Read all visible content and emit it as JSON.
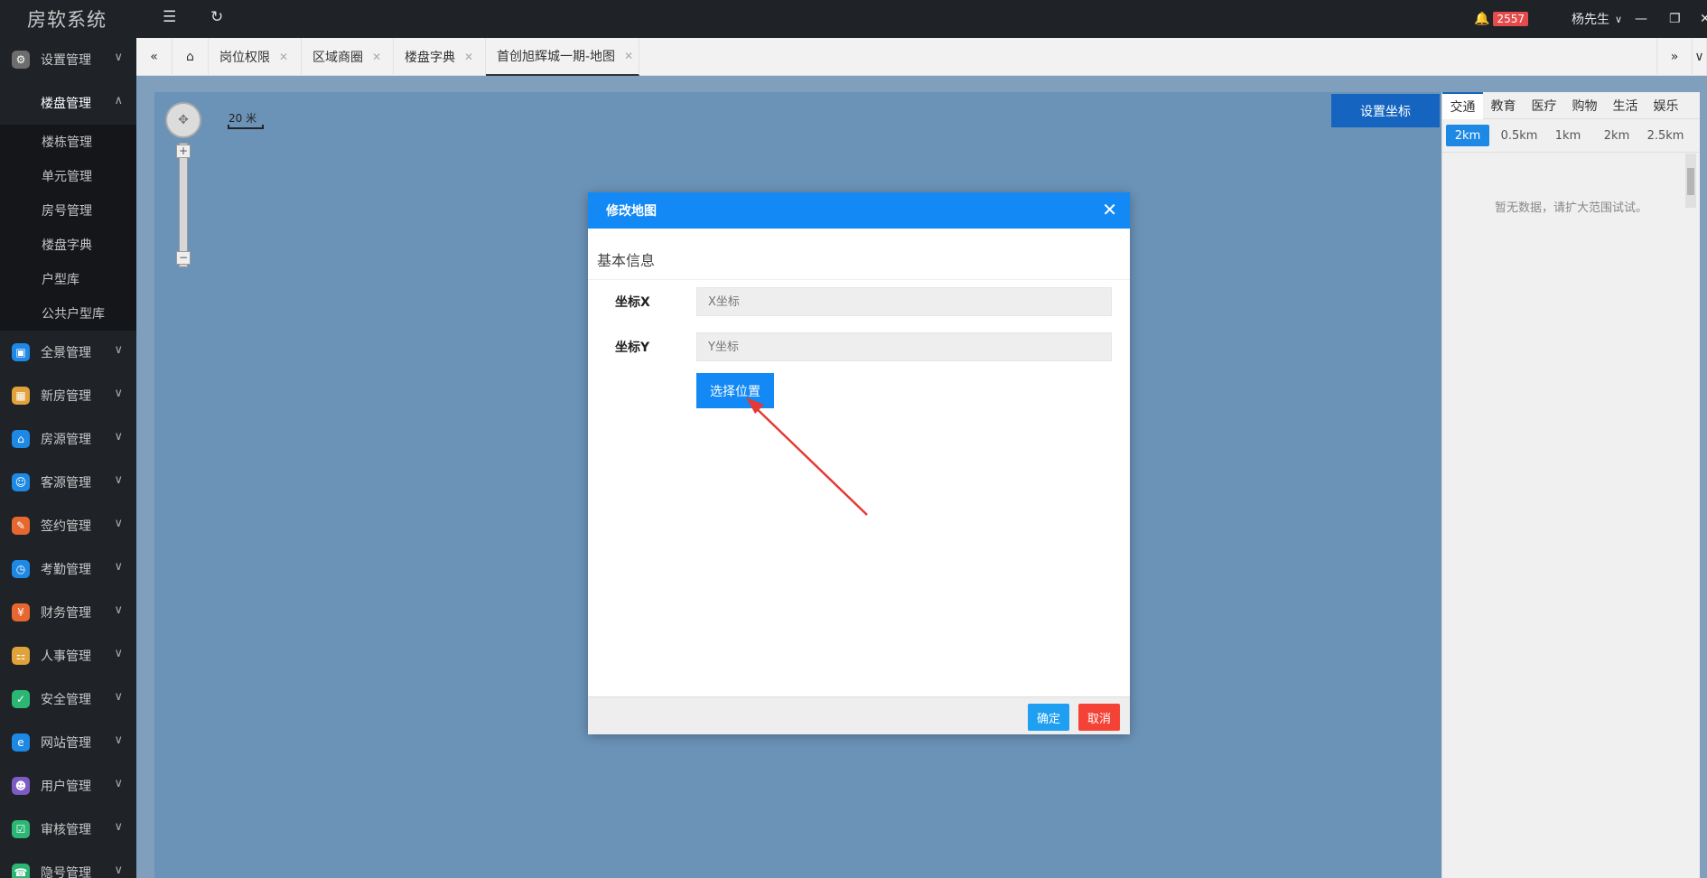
{
  "app": {
    "title": "房软系统"
  },
  "topbar": {
    "notification_count": "2557",
    "user_name": "杨先生"
  },
  "sidebar": {
    "items": [
      {
        "label": "设置管理",
        "icon": "gear-icon",
        "color": "#6d6d6d"
      },
      {
        "label": "楼盘管理",
        "icon": "building-icon",
        "color": "#1f2227"
      }
    ],
    "subitems": [
      "楼栋管理",
      "单元管理",
      "房号管理",
      "楼盘字典",
      "户型库",
      "公共户型库"
    ],
    "more": [
      {
        "label": "全景管理",
        "icon": "panorama-icon",
        "color": "#1e88e5"
      },
      {
        "label": "新房管理",
        "icon": "newhouse-icon",
        "color": "#e0a23a"
      },
      {
        "label": "房源管理",
        "icon": "home-icon",
        "color": "#1e88e5"
      },
      {
        "label": "客源管理",
        "icon": "customer-icon",
        "color": "#1e88e5"
      },
      {
        "label": "签约管理",
        "icon": "contract-icon",
        "color": "#e6672f"
      },
      {
        "label": "考勤管理",
        "icon": "clock-icon",
        "color": "#1e88e5"
      },
      {
        "label": "财务管理",
        "icon": "finance-icon",
        "color": "#e6672f"
      },
      {
        "label": "人事管理",
        "icon": "org-icon",
        "color": "#e0a23a"
      },
      {
        "label": "安全管理",
        "icon": "shield-icon",
        "color": "#2bb673"
      },
      {
        "label": "网站管理",
        "icon": "web-icon",
        "color": "#1e88e5"
      },
      {
        "label": "用户管理",
        "icon": "user-icon",
        "color": "#7c5cc4"
      },
      {
        "label": "审核管理",
        "icon": "audit-icon",
        "color": "#2bb673"
      },
      {
        "label": "隐号管理",
        "icon": "phone-icon",
        "color": "#2bb673"
      }
    ]
  },
  "tabs": [
    {
      "label": "岗位权限"
    },
    {
      "label": "区域商圈"
    },
    {
      "label": "楼盘字典"
    },
    {
      "label": "首创旭辉城一期-地图"
    }
  ],
  "map": {
    "scale_label": "20 米",
    "set_coord_label": "设置坐标"
  },
  "poi": {
    "tabs": [
      "交通",
      "教育",
      "医疗",
      "购物",
      "生活",
      "娱乐"
    ],
    "ranges": [
      "2km",
      "0.5km",
      "1km",
      "2km",
      "2.5km"
    ],
    "empty_text": "暂无数据，请扩大范围试试。"
  },
  "dialog": {
    "title": "修改地图",
    "section": "基本信息",
    "x_label": "坐标X",
    "x_placeholder": "X坐标",
    "y_label": "坐标Y",
    "y_placeholder": "Y坐标",
    "choose_label": "选择位置",
    "ok_label": "确定",
    "cancel_label": "取消"
  },
  "colors": {
    "primary": "#1289f5",
    "danger": "#f44336",
    "ok": "#1e9ff2"
  }
}
